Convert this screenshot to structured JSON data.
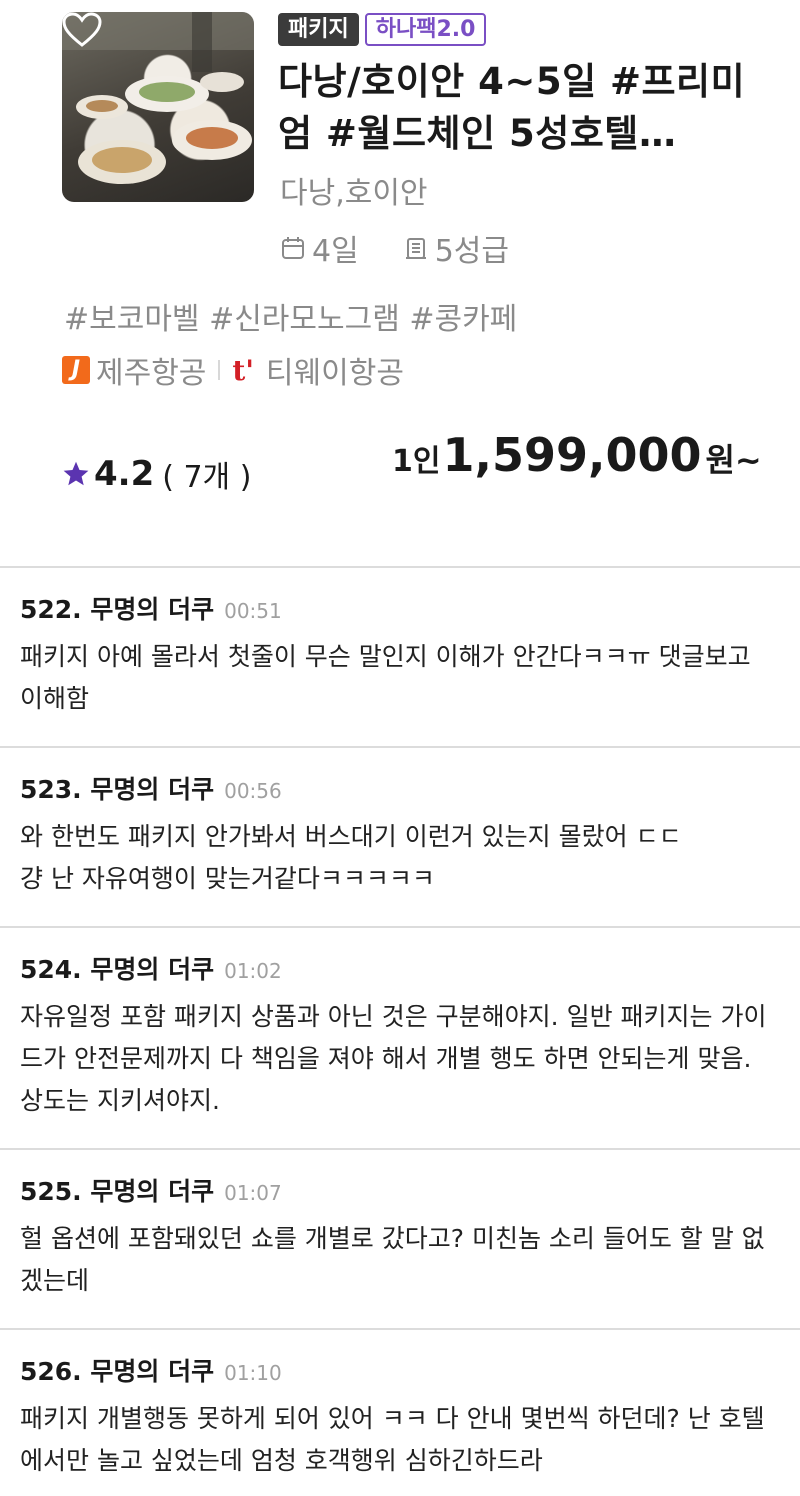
{
  "product": {
    "badges": {
      "type": "패키지",
      "series": "하나팩2.0"
    },
    "title": "다낭/호이안 4~5일 #프리미엄 #월드체인 5성호텔…",
    "region": "다낭,호이안",
    "duration": "4일",
    "hotel_grade": "5성급",
    "tags": "#보코마벨 #신라모노그램 #콩카페",
    "airlines": [
      {
        "icon": "jeju-air-logo",
        "name": "제주항공"
      },
      {
        "icon": "tway-air-logo",
        "name": "티웨이항공"
      }
    ],
    "rating": {
      "value": "4.2",
      "count": "( 7개 )"
    },
    "price": {
      "prefix": "1인",
      "amount": "1,599,000",
      "suffix": "원~"
    },
    "colors": {
      "accent_purple": "#7a4fc4",
      "jeju_orange": "#f26a1b",
      "tway_red": "#d31f26"
    }
  },
  "comments": [
    {
      "author": "522. 무명의 더쿠",
      "time": "00:51",
      "text": "패키지 아예 몰라서 첫줄이 무슨 말인지 이해가 안간다ㅋㅋㅠ 댓글보고 이해함"
    },
    {
      "author": "523. 무명의 더쿠",
      "time": "00:56",
      "text": "와 한번도 패키지 안가봐서 버스대기 이런거 있는지 몰랐어 ㄷㄷ\n걍 난 자유여행이 맞는거같다ㅋㅋㅋㅋㅋ"
    },
    {
      "author": "524. 무명의 더쿠",
      "time": "01:02",
      "text": "자유일정 포함 패키지 상품과 아닌 것은 구분해야지. 일반 패키지는 가이드가 안전문제까지 다 책임을 져야 해서 개별 행도 하면 안되는게 맞음.  상도는 지키셔야지."
    },
    {
      "author": "525. 무명의 더쿠",
      "time": "01:07",
      "text": "헐 옵션에 포함돼있던 쇼를 개별로 갔다고? 미친놈 소리 들어도 할 말 없겠는데"
    },
    {
      "author": "526. 무명의 더쿠",
      "time": "01:10",
      "text": "패키지 개별행동 못하게 되어 있어 ㅋㅋ 다 안내 몇번씩 하던데? 난 호텔에서만 놀고 싶었는데 엄청 호객행위 심하긴하드라"
    }
  ]
}
